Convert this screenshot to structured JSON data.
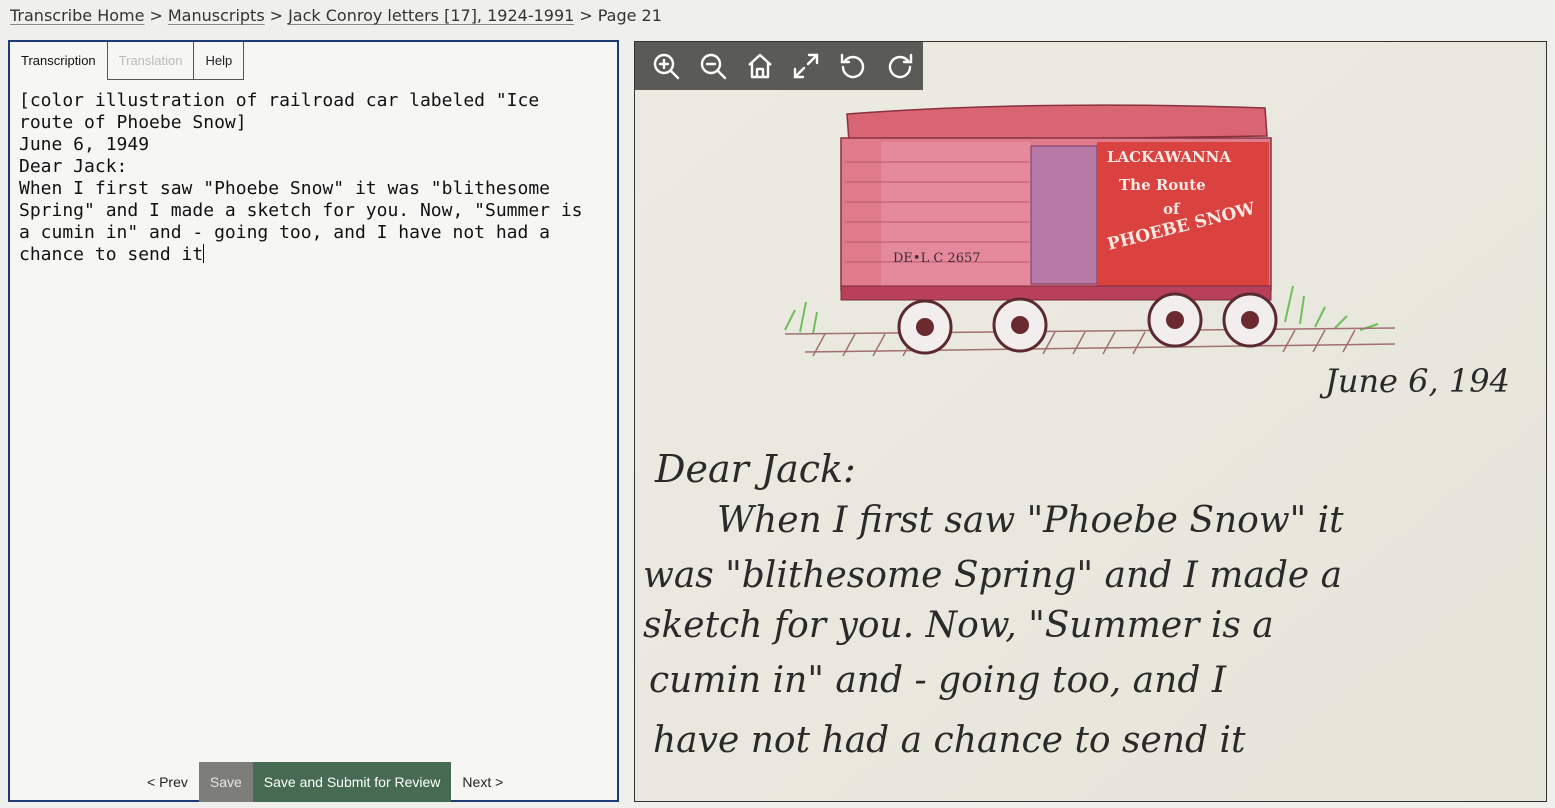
{
  "breadcrumb": {
    "items": [
      "Transcribe Home",
      "Manuscripts",
      "Jack Conroy letters [17], 1924-1991"
    ],
    "current": "Page 21",
    "separator": ">"
  },
  "tabs": {
    "transcription": "Transcription",
    "translation": "Translation",
    "help": "Help"
  },
  "transcription_text": "[color illustration of railroad car labeled \"Ice\nroute of Phoebe Snow]\nJune 6, 1949\nDear Jack:\nWhen I first saw \"Phoebe Snow\" it was \"blithesome\nSpring\" and I made a sketch for you. Now, \"Summer is\na cumin in\" and - going too, and I have not had a\nchance to send it",
  "buttons": {
    "prev": "< Prev",
    "save": "Save",
    "submit": "Save and Submit for Review",
    "next": "Next >"
  },
  "viewer": {
    "tools": [
      "zoom-in-icon",
      "zoom-out-icon",
      "home-icon",
      "fullscreen-icon",
      "rotate-left-icon",
      "rotate-right-icon"
    ],
    "car_label_left": "DE•L C 2657",
    "car_sign": [
      "LACKAWANNA",
      "The Route",
      "of",
      "PHOEBE SNOW"
    ],
    "letter_date": "June 6, 194",
    "letter_lines": [
      "Dear Jack:",
      "When I first saw \"Phoebe Snow\" it",
      "was \"blithesome Spring\" and I made a",
      "sketch for you. Now, \"Summer is a",
      "cumin in\" and - going too, and I",
      "have not had a chance to send it"
    ]
  },
  "colors": {
    "panel_border": "#1f3b73",
    "submit_bg": "#466b52",
    "save_bg": "#7d7d7a",
    "paper": "#ebeae1",
    "ink": "#2a2a2a",
    "car_red": "#d4505e"
  }
}
